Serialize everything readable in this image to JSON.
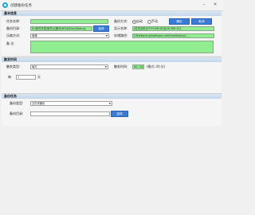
{
  "window": {
    "title": "创建备份任务"
  },
  "basic": {
    "header": "基本信息",
    "task_name_label": "任务名称:",
    "task_name_value": "",
    "backup_mode_label": "备份方式:",
    "mode_auto_label": "自动",
    "mode_manual_label": "手动",
    "auto_button": "确定",
    "manual_button": "取消",
    "folder_label": "备份目录:",
    "folder_value": "D:\\软件开发\\组件\\云备份\\BG\\BG\\bin\\Debug\\",
    "folder_select_button": "选择",
    "display_name_label": "显示名称:",
    "display_name_value": "[任务名称][YYYY-MM-DD][HH-MM-SS]",
    "compress_label": "压缩方式:",
    "compress_value": "普通",
    "store_path_label": "存储路径:",
    "store_path_value": "\\\\TestBackup\\Software.net\\FormBackup\\...",
    "remark_label": "备 注:",
    "remark_value": ""
  },
  "schedule": {
    "header": "触发时间",
    "type_label": "触发类型:",
    "type_value": "每天",
    "time_label": "触发时间:",
    "time_value": "00 : 00",
    "time_hint": "(格式: 时:分)",
    "every_label": "每",
    "every_value": "1",
    "every_unit": "天"
  },
  "restore": {
    "header": "备份任务",
    "type_label": "备份类型:",
    "type_value": "文件夹备份",
    "target_label": "备份目录:",
    "target_value": "",
    "target_button": "选择"
  },
  "colors": {
    "field_green": "#90ee90",
    "button_blue": "#3a7bd5",
    "header_blue": "#c3d6ea"
  }
}
